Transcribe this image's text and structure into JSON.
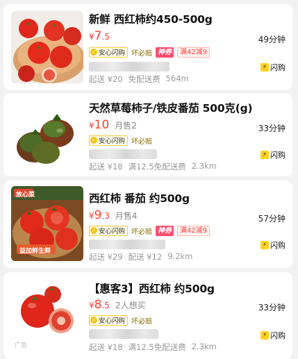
{
  "products": [
    {
      "title": "新鲜 西红柿约450-500g",
      "price_symbol": "¥",
      "price_int": "7",
      "price_dec": ".5",
      "sold": "",
      "eta": "49分钟",
      "tag_safe": "安心闪购",
      "tag_bad": "坏必赔",
      "tag_god": "神券",
      "tag_promo": "满42减9",
      "shop_button": "闪购",
      "footer": [
        "起送 ¥20",
        "免配送费",
        "564m"
      ],
      "ad_label": ""
    },
    {
      "title": "天然草莓柿子/铁皮番茄 500克(g)",
      "price_symbol": "¥",
      "price_int": "10",
      "price_dec": "",
      "sold": "月售2",
      "eta": "33分钟",
      "tag_safe": "安心闪购",
      "tag_bad": "坏必赔",
      "tag_god": "",
      "tag_promo": "",
      "shop_button": "闪购",
      "footer": [
        "起送 ¥18",
        "满12.5免配送费",
        "2.3km"
      ],
      "ad_label": ""
    },
    {
      "title": "西红柿 番茄 约500g",
      "price_symbol": "¥",
      "price_int": "9",
      "price_dec": ".3",
      "sold": "月售4",
      "eta": "57分钟",
      "tag_safe": "安心闪购",
      "tag_bad": "坏必赔",
      "tag_god": "神券",
      "tag_promo": "满42减9",
      "shop_button": "闪购",
      "footer": [
        "起送 ¥29",
        "配送 ¥12",
        "9.2km"
      ],
      "ad_label": "",
      "image_badge_top": "放心菜",
      "image_badge_bottom": "益加鲜生鲜"
    },
    {
      "title": "【惠客3】西红柿 约500g",
      "price_symbol": "¥",
      "price_int": "8",
      "price_dec": ".5",
      "sold": "2人想买",
      "eta": "33分钟",
      "tag_safe": "安心闪购",
      "tag_bad": "坏必赔",
      "tag_god": "",
      "tag_promo": "",
      "shop_button": "闪购",
      "footer": [
        "起送 ¥18",
        "满12.5免配送费",
        "2.3km"
      ],
      "ad_label": "广告"
    }
  ],
  "colors": {
    "price": "#ff3b30",
    "accent_yellow": "#ffd21f",
    "god_tag": "#ff4d6d"
  },
  "icons": [
    "tomato-image",
    "check-icon",
    "bolt-icon"
  ]
}
